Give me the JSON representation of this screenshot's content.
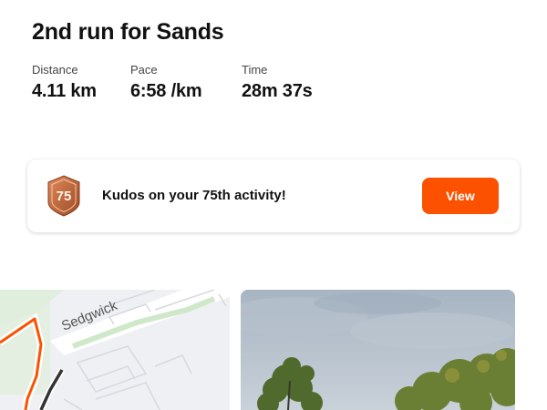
{
  "activity": {
    "title": "2nd run for Sands",
    "stats": [
      {
        "label": "Distance",
        "value": "4.11 km"
      },
      {
        "label": "Pace",
        "value": "6:58 /km"
      },
      {
        "label": "Time",
        "value": "28m 37s"
      }
    ]
  },
  "achievement": {
    "badge_number": "75",
    "text": "Kudos on your 75th activity!",
    "button_label": "View",
    "accent_color": "#fc5200",
    "badge_color": "#c46a3c"
  },
  "map": {
    "street_label": "Sedgwick",
    "route_color": "#fc5200"
  },
  "photo": {
    "subject": "trees-under-cloudy-sky"
  }
}
